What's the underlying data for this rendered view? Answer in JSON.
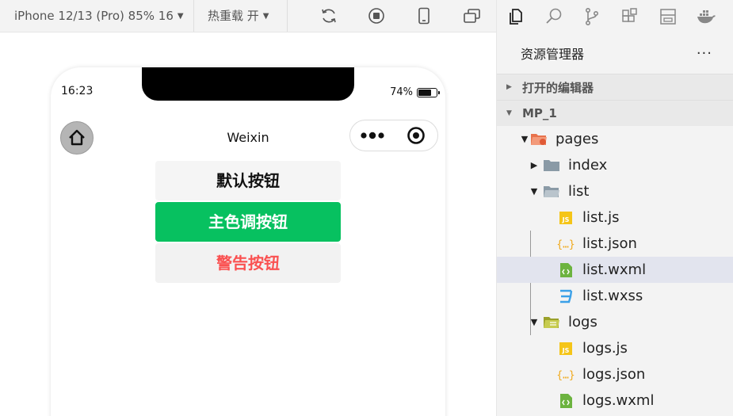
{
  "toolbar": {
    "device_select": "iPhone 12/13 (Pro) 85% 16",
    "hot_reload_select": "热重载 开"
  },
  "phone": {
    "status_time": "16:23",
    "battery_text": "74%",
    "battery_level": 0.74,
    "nav_title": "Weixin"
  },
  "buttons": {
    "default_label": "默认按钮",
    "primary_label": "主色调按钮",
    "warn_label": "警告按钮"
  },
  "explorer": {
    "title": "资源管理器",
    "more": "···",
    "open_editors": "打开的编辑器",
    "project": "MP_1",
    "tree": [
      {
        "label": "pages",
        "kind": "folder-open-pages",
        "expanded": true
      },
      {
        "label": "index",
        "kind": "folder",
        "expanded": false
      },
      {
        "label": "list",
        "kind": "folder-open",
        "expanded": true
      },
      {
        "label": "list.js",
        "kind": "js"
      },
      {
        "label": "list.json",
        "kind": "json"
      },
      {
        "label": "list.wxml",
        "kind": "wxml",
        "selected": true
      },
      {
        "label": "list.wxss",
        "kind": "wxss"
      },
      {
        "label": "logs",
        "kind": "folder-logs",
        "expanded": true
      },
      {
        "label": "logs.js",
        "kind": "js"
      },
      {
        "label": "logs.json",
        "kind": "json"
      },
      {
        "label": "logs.wxml",
        "kind": "wxml"
      }
    ]
  },
  "colors": {
    "primary": "#07c160",
    "warn": "#fa5151",
    "selection": "#e2e4ee"
  }
}
